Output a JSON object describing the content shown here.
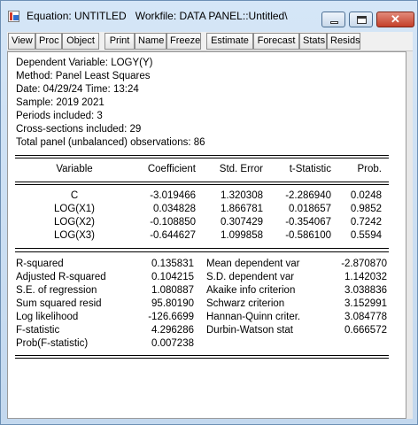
{
  "window": {
    "title": "Equation: UNTITLED   Workfile: DATA PANEL::Untitled\\",
    "close_glyph": "✕"
  },
  "toolbar": {
    "buttons": [
      "View",
      "Proc",
      "Object",
      "Print",
      "Name",
      "Freeze",
      "Estimate",
      "Forecast",
      "Stats",
      "Resids"
    ]
  },
  "header": {
    "lines": [
      "Dependent Variable: LOGY(Y)",
      "Method: Panel Least Squares",
      "Date: 04/29/24   Time: 13:24",
      "Sample: 2019 2021",
      "Periods included: 3",
      "Cross-sections included: 29",
      "Total panel (unbalanced) observations: 86"
    ]
  },
  "coef_table": {
    "columns": [
      "Variable",
      "Coefficient",
      "Std. Error",
      "t-Statistic",
      "Prob."
    ],
    "rows": [
      [
        "C",
        "-3.019466",
        "1.320308",
        "-2.286940",
        "0.0248"
      ],
      [
        "LOG(X1)",
        "0.034828",
        "1.866781",
        "0.018657",
        "0.9852"
      ],
      [
        "LOG(X2)",
        "-0.108850",
        "0.307429",
        "-0.354067",
        "0.7242"
      ],
      [
        "LOG(X3)",
        "-0.644627",
        "1.099858",
        "-0.586100",
        "0.5594"
      ]
    ]
  },
  "stats": {
    "left": [
      {
        "label": "R-squared",
        "value": "0.135831"
      },
      {
        "label": "Adjusted R-squared",
        "value": "0.104215"
      },
      {
        "label": "S.E. of regression",
        "value": "1.080887"
      },
      {
        "label": "Sum squared resid",
        "value": "95.80190"
      },
      {
        "label": "Log likelihood",
        "value": "-126.6699"
      },
      {
        "label": "F-statistic",
        "value": "4.296286"
      },
      {
        "label": "Prob(F-statistic)",
        "value": "0.007238"
      }
    ],
    "right": [
      {
        "label": "Mean dependent var",
        "value": "-2.870870"
      },
      {
        "label": "S.D. dependent var",
        "value": "1.142032"
      },
      {
        "label": "Akaike info criterion",
        "value": "3.038836"
      },
      {
        "label": "Schwarz criterion",
        "value": "3.152991"
      },
      {
        "label": "Hannan-Quinn criter.",
        "value": "3.084778"
      },
      {
        "label": "Durbin-Watson stat",
        "value": "0.666572"
      }
    ]
  }
}
